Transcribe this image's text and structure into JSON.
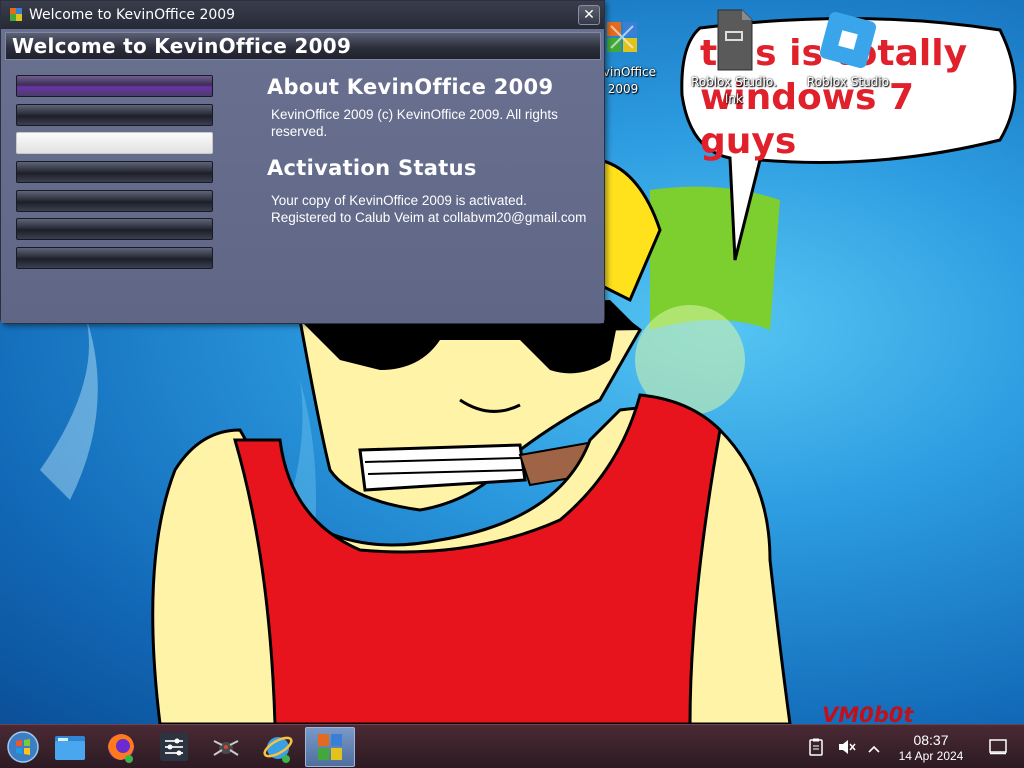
{
  "window": {
    "title": "Welcome to KevinOffice 2009",
    "close_glyph": "✕",
    "header": "Welcome to KevinOffice 2009",
    "about_title": "About KevinOffice 2009",
    "about_text_line1": "KevinOffice 2009 (c) KevinOffice 2009. All rights",
    "about_text_line2": "reserved.",
    "activation_title": "Activation Status",
    "activation_text_line1": "Your copy of KevinOffice 2009 is activated.",
    "activation_text_line2": "Registered to Calub Veim at collabvm20@gmail.com",
    "sidebar_buttons": 7,
    "active_button_index": 2
  },
  "desktop": {
    "icons": [
      {
        "label_line1": "vinOffice",
        "label_line2": "2009",
        "icon": "kevinoffice-icon"
      },
      {
        "label_line1": "Roblox Studio.",
        "label_line2": "lnk",
        "icon": "shortcut-file-icon"
      },
      {
        "label_line1": "Roblox Studio",
        "label_line2": "",
        "icon": "roblox-studio-icon"
      }
    ],
    "speech_bubble_text_line1": "this is totally",
    "speech_bubble_text_line2": "windows 7 guys",
    "signature": "VM0b0t"
  },
  "taskbar": {
    "apps": [
      {
        "name": "start-button",
        "icon": "windows-orb-icon"
      },
      {
        "name": "file-manager",
        "icon": "folder-icon"
      },
      {
        "name": "firefox",
        "icon": "firefox-icon"
      },
      {
        "name": "settings-mixer",
        "icon": "sliders-icon"
      },
      {
        "name": "bug-app",
        "icon": "bug-icon"
      },
      {
        "name": "ie-app",
        "icon": "internet-explorer-icon"
      },
      {
        "name": "kevinoffice",
        "icon": "kevinoffice-icon",
        "active": true
      }
    ],
    "time": "08:37",
    "date": "14 Apr 2024"
  },
  "colors": {
    "taskbar": "#3a2029",
    "window_body": "#626a89",
    "bubble_text": "#e0202a"
  }
}
